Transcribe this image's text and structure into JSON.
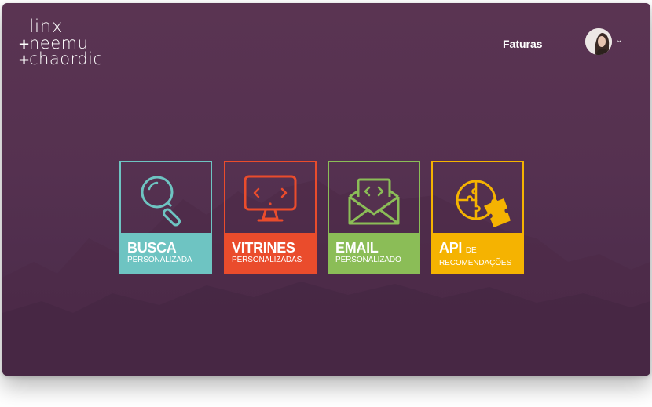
{
  "brand": {
    "line1": "linx",
    "line2": "neemu",
    "line3": "chaordic",
    "plus": "+"
  },
  "header": {
    "faturas_label": "Faturas",
    "chevron": "⌄"
  },
  "tiles": [
    {
      "title": "BUSCA",
      "title_suffix": "",
      "subtitle": "PERSONALIZADA",
      "icon": "magnifier-icon",
      "color": "#6ec4c2"
    },
    {
      "title": "VITRINES",
      "title_suffix": "",
      "subtitle": "PERSONALIZADAS",
      "icon": "monitor-icon",
      "color": "#ea4c2c"
    },
    {
      "title": "EMAIL",
      "title_suffix": "",
      "subtitle": "PERSONALIZADO",
      "icon": "envelope-icon",
      "color": "#8bbd57"
    },
    {
      "title": "API",
      "title_suffix": "DE",
      "subtitle": "RECOMENDAÇÕES",
      "icon": "puzzle-icon",
      "color": "#f5b301"
    }
  ],
  "colors": {
    "background": "#55314f",
    "text": "#ffffff"
  }
}
